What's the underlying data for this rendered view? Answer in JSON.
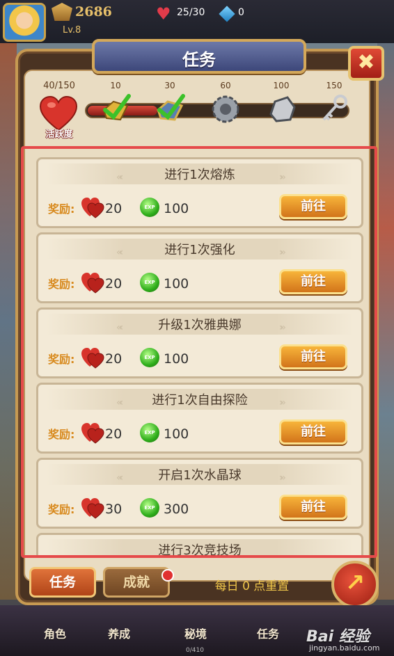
{
  "hud": {
    "power": "2686",
    "level": "Lv.8",
    "stamina": "25/30",
    "gems": "0"
  },
  "dialog": {
    "title": "任务",
    "close_label": "✖"
  },
  "activity": {
    "count": "40/150",
    "label": "活跃度",
    "progress_fraction": 0.27,
    "milestones": [
      {
        "label": "10",
        "icon": "gold-chest-checked-icon"
      },
      {
        "label": "30",
        "icon": "blue-chest-checked-icon"
      },
      {
        "label": "60",
        "icon": "silver-gear-icon"
      },
      {
        "label": "100",
        "icon": "stone-icon"
      },
      {
        "label": "150",
        "icon": "key-icon"
      }
    ]
  },
  "tasks": [
    {
      "title": "进行1次熔炼",
      "reward_label": "奖励:",
      "heart": "20",
      "exp": "100",
      "go_label": "前往"
    },
    {
      "title": "进行1次强化",
      "reward_label": "奖励:",
      "heart": "20",
      "exp": "100",
      "go_label": "前往"
    },
    {
      "title": "升级1次雅典娜",
      "reward_label": "奖励:",
      "heart": "20",
      "exp": "100",
      "go_label": "前往"
    },
    {
      "title": "进行1次自由探险",
      "reward_label": "奖励:",
      "heart": "20",
      "exp": "100",
      "go_label": "前往"
    },
    {
      "title": "开启1次水晶球",
      "reward_label": "奖励:",
      "heart": "30",
      "exp": "300",
      "go_label": "前往"
    },
    {
      "title": "进行3次竞技场"
    }
  ],
  "exp_badge": "EXP",
  "tabs": {
    "task": "任务",
    "achievement": "成就",
    "reset_notice": "每日 0 点重置"
  },
  "nav": {
    "role": "角色",
    "cultivate": "养成",
    "secret": "秘境",
    "secret_sub": "0/410",
    "task": "任务"
  },
  "watermark": {
    "logo": "Bai 经验",
    "url": "jingyan.baidu.com"
  },
  "colors": {
    "highlight_frame": "#e54a4a",
    "go_button": "#e58a24",
    "reward_label": "#d88a1e",
    "reset_text": "#f0c64a"
  }
}
